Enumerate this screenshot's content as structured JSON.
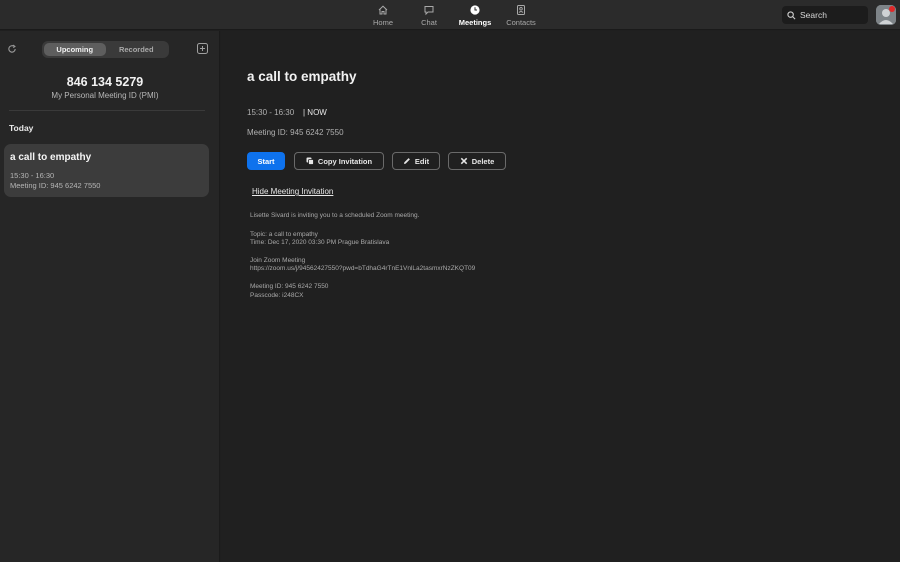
{
  "nav": {
    "items": [
      {
        "label": "Home",
        "icon": "home-icon"
      },
      {
        "label": "Chat",
        "icon": "chat-icon"
      },
      {
        "label": "Meetings",
        "icon": "clock-icon"
      },
      {
        "label": "Contacts",
        "icon": "contacts-icon"
      }
    ],
    "active": "Meetings"
  },
  "search": {
    "label": "Search"
  },
  "sidebar": {
    "tabs": {
      "upcoming": "Upcoming",
      "recorded": "Recorded"
    },
    "pmi": {
      "number": "846 134 5279",
      "label": "My Personal Meeting ID (PMI)"
    },
    "section": "Today",
    "meeting": {
      "title": "a call to empathy",
      "time": "15:30 - 16:30",
      "meeting_id": "Meeting ID: 945 6242 7550"
    }
  },
  "main": {
    "title": "a call to empathy",
    "time": "15:30 - 16:30",
    "status": "| NOW",
    "meeting_id": "Meeting ID: 945 6242 7550",
    "buttons": {
      "start": "Start",
      "copy": "Copy Invitation",
      "edit": "Edit",
      "delete": "Delete"
    },
    "hide_link": "Hide Meeting Invitation",
    "invitation": [
      "Lisette Sivard is inviting you to a scheduled Zoom meeting.",
      "Topic: a call to empathy",
      "Time: Dec 17, 2020 03:30 PM Prague Bratislava",
      "Join Zoom Meeting",
      "https://zoom.us/j/94562427550?pwd=bTdhaG4rTnE1VnlLa2tasmxrNzZKQT09",
      "Meeting ID: 945 6242 7550",
      "Passcode: i248CX"
    ]
  },
  "colors": {
    "accent": "#0e72ed",
    "background": "#202020",
    "sidebar": "#262626",
    "badge": "#e02828"
  }
}
